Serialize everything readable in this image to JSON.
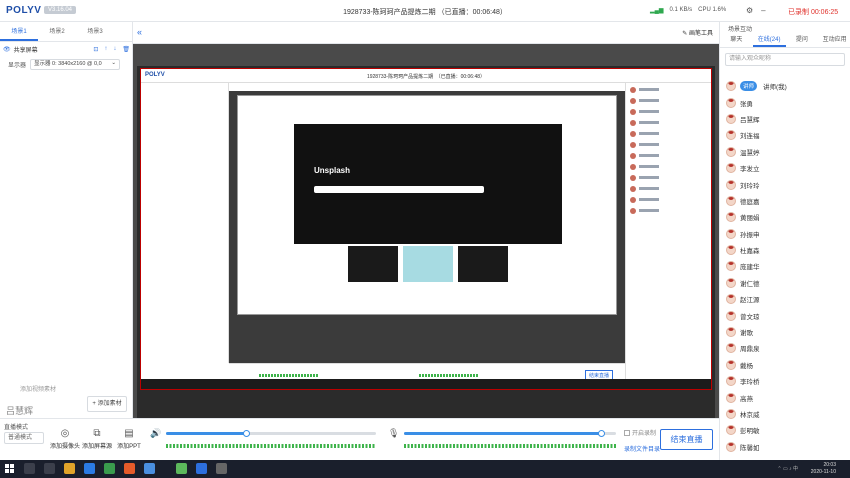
{
  "app": {
    "logo": "POLYV",
    "version": "V3.16.04",
    "window_title": "1928733-陈珂珂产品提炼二期",
    "live_status": "（已直播：00:06:48）",
    "signal": "0.1 KB/s",
    "cpu": "CPU 1.6%",
    "recording": "已录制 00:06:25"
  },
  "scenes": [
    "场景1",
    "场景2",
    "场景3"
  ],
  "source": {
    "name": "共享屏幕",
    "display_label": "显示器",
    "display_value": "显示器 0: 3840x2160 @ 0,0"
  },
  "left_panel": {
    "add_source": "添加视频素材",
    "add_material": "+ 添加素材",
    "host": "吕慧辉"
  },
  "toolbar": {
    "pen_tool": "画笔工具"
  },
  "nested": {
    "title": "1928733-陈珂珂产品提炼二期　（已直播：00:06:48）",
    "site_title": "Unsplash",
    "live_label": "结束直播"
  },
  "bottom": {
    "mode_label": "直播模式",
    "mode_value": "普通模式",
    "btn_camera": "添加摄像头",
    "btn_screen": "添加屏幕源",
    "btn_ppt": "添加PPT",
    "speaker_level": 0.38,
    "mic_level": 0.93,
    "checkbox": "开启录制",
    "folder_link": "录制文件目录",
    "live_button": "结束直播"
  },
  "right": {
    "title": "场景互动",
    "tabs": [
      "聊天",
      "在线(24)",
      "提问",
      "互动应用"
    ],
    "search_placeholder": "请输入观众昵称",
    "teacher_badge": "讲师",
    "participants": [
      "讲师(我)",
      "张勇",
      "吕慧辉",
      "刘连福",
      "温慧婷",
      "李发立",
      "刘玲玲",
      "德庭嘉",
      "黄丽娟",
      "孙振申",
      "杜嘉森",
      "庞建华",
      "谢仁德",
      "赵江源",
      "曾文琼",
      "谢歌",
      "周鼎泉",
      "戴杨",
      "李玲桥",
      "高燕",
      "林京威",
      "彭明敏",
      "陈馨如"
    ]
  },
  "taskbar": {
    "time": "20:03",
    "date": "2020-11-10"
  },
  "colors": {
    "accent": "#2d6fde",
    "meter": "#3db34a",
    "record": "#e0322c"
  }
}
